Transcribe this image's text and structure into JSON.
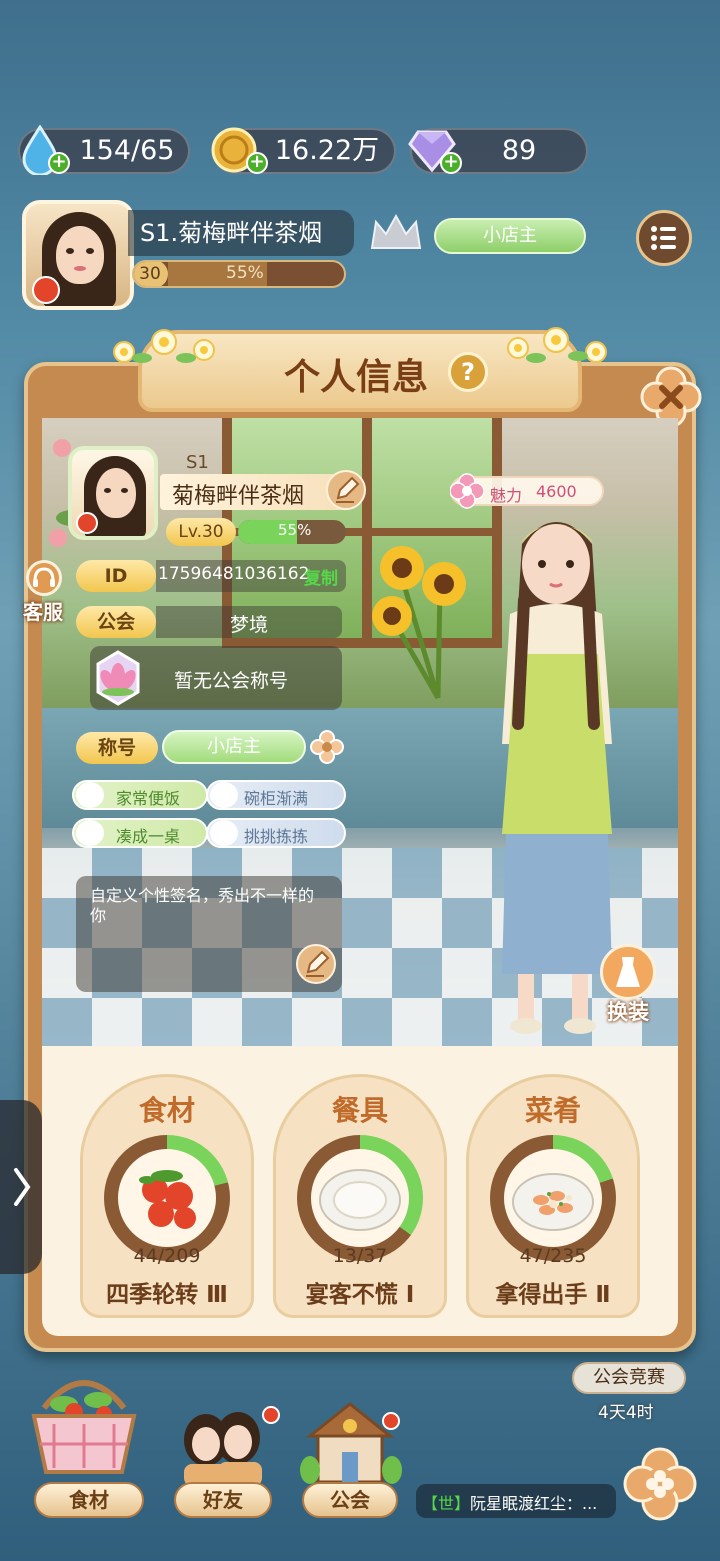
{
  "resources": {
    "water": "154/65",
    "coins": "16.22万",
    "gems": "89"
  },
  "player": {
    "server_name": "S1.菊梅畔伴茶烟",
    "level": "30",
    "progress_text": "55%",
    "progress": 0.55,
    "rank_badge": "小店主"
  },
  "side": {
    "service": "客服"
  },
  "panel": {
    "title": "个人信息",
    "help_icon": "?",
    "server": "S1",
    "name": "菊梅畔伴茶烟",
    "level": "Lv.30",
    "level_progress": "55%",
    "level_progress_value": 0.55,
    "charm_label": "魅力",
    "charm_value": "4600",
    "id_label": "ID",
    "id_value": "17596481036162",
    "copy": "复制",
    "guild_label": "公会",
    "guild_value": "梦境",
    "guild_title": "暂无公会称号",
    "title_label": "称号",
    "title_value": "小店主",
    "badges": [
      "家常便饭",
      "碗柜渐满",
      "凑成一桌",
      "挑挑拣拣"
    ],
    "signature": "自定义个性签名，秀出不一样的你",
    "dress_button": "换装"
  },
  "collections": [
    {
      "title": "食材",
      "count": "44/209",
      "level": "四季轮转 Ⅲ",
      "progress": 0.21,
      "icon": "tomato-icon"
    },
    {
      "title": "餐具",
      "count": "13/37",
      "level": "宴客不慌 Ⅰ",
      "progress": 0.35,
      "icon": "plate-icon"
    },
    {
      "title": "菜肴",
      "count": "47/235",
      "level": "拿得出手 Ⅱ",
      "progress": 0.2,
      "icon": "dish-icon"
    }
  ],
  "event": {
    "label": "公会竞赛",
    "time": "4天4时"
  },
  "nav": {
    "ingredients": "食材",
    "friends": "好友",
    "guild": "公会"
  },
  "chat": {
    "channel": "【世】",
    "text": "阮星眠渡红尘：..."
  },
  "colors": {
    "panel_border": "#e7c48d",
    "title_orange": "#c16b2a",
    "progress_green": "#7ad35a",
    "pill_yellow": "#f2c64e"
  }
}
